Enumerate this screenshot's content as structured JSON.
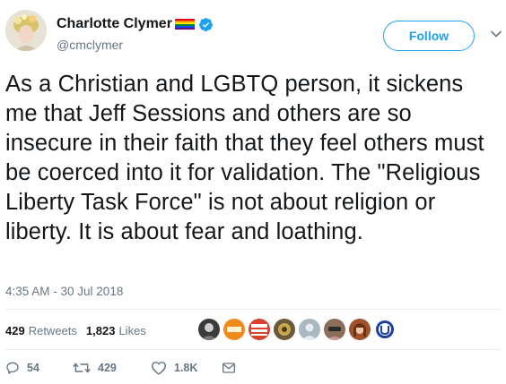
{
  "user": {
    "display_name": "Charlotte Clymer",
    "handle": "@cmclymer",
    "flag_colors": [
      "#e40303",
      "#ff8c00",
      "#ffed00",
      "#008026",
      "#004dff",
      "#750787"
    ],
    "verified_color": "#1da1f2"
  },
  "follow_button": {
    "label": "Follow"
  },
  "tweet": {
    "text": "As a Christian and LGBTQ person, it sickens me that Jeff Sessions and others are so insecure in their faith that they feel others must be coerced into it for validation. The \"Religious Liberty Task Force\" is not about religion or liberty. It is about fear and loathing.",
    "timestamp": "4:35 AM - 30 Jul 2018"
  },
  "stats": {
    "retweets_count": "429",
    "retweets_label": "Retweets",
    "likes_count": "1,823",
    "likes_label": "Likes",
    "liker_avatars": [
      "#3b3b3b",
      "#f08a1c",
      "#d8412f",
      "#6b5a3a",
      "#aab8c2",
      "#8a6e5a",
      "#a0522d",
      "#1d3fa0"
    ]
  },
  "actions": {
    "reply_count": "54",
    "retweet_count": "429",
    "like_count": "1.8K"
  },
  "colors": {
    "accent": "#1da1f2",
    "secondary_text": "#657786",
    "primary_text": "#14171a"
  }
}
